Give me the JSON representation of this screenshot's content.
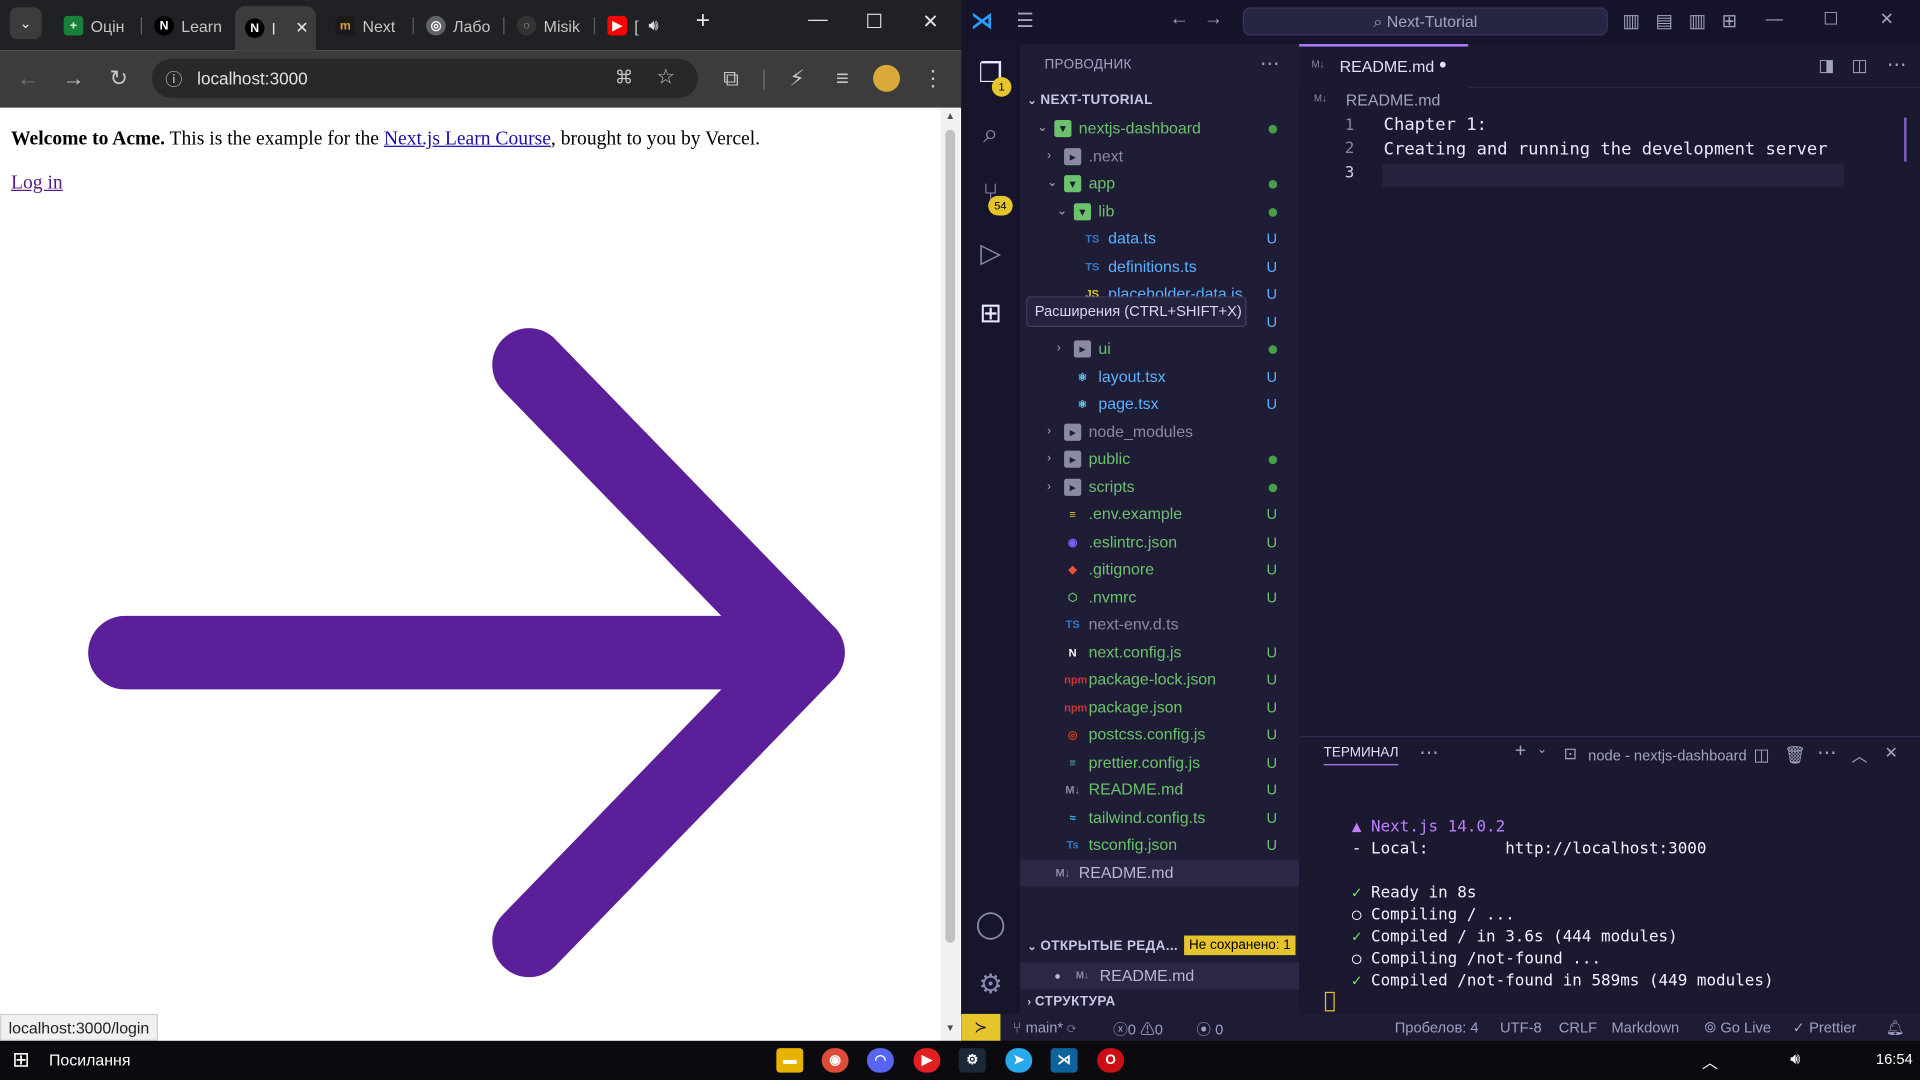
{
  "chrome": {
    "tabs": [
      {
        "title": "Оцін",
        "favicon": "sheets-icon",
        "color": "#188038"
      },
      {
        "title": "Learn",
        "favicon": "nextjs-icon",
        "color": "#000000"
      },
      {
        "title": "l",
        "favicon": "nextjs-icon",
        "color": "#000000"
      },
      {
        "title": "Next",
        "favicon": "dev-icon",
        "color": "#e5a233"
      },
      {
        "title": "Лабо",
        "favicon": "globe-icon",
        "color": "#5f6368"
      },
      {
        "title": "Misik",
        "favicon": "github-icon",
        "color": "#333333"
      },
      {
        "title": "[",
        "favicon": "youtube-icon",
        "color": "#ff0000"
      }
    ],
    "new_tab": "+",
    "url": "localhost:3000",
    "status_url": "localhost:3000/login"
  },
  "page": {
    "welcome_bold": "Welcome to Acme.",
    "welcome_rest_1": " This is the example for the ",
    "course_link": "Next.js Learn Course",
    "welcome_rest_2": ", brought to you by Vercel.",
    "login_link": "Log in",
    "arrow_color": "#5b1f9a"
  },
  "vscode": {
    "search": "Next-Tutorial",
    "explorer_title": "ПРОВОДНИК",
    "root": "NEXT-TUTORIAL",
    "tree": [
      {
        "name": "nextjs-dashboard",
        "kind": "folder-open",
        "status": "dot",
        "color": "#6cc26c"
      },
      {
        "name": ".next",
        "kind": "folder",
        "status": "",
        "color": "#8a8aa5"
      },
      {
        "name": "app",
        "kind": "folder-open",
        "status": "dot",
        "color": "#6cc26c"
      },
      {
        "name": "lib",
        "kind": "folder-open",
        "status": "dot",
        "color": "#6cc26c"
      },
      {
        "name": "data.ts",
        "kind": "ts",
        "status": "U",
        "color": "#5ab1ff"
      },
      {
        "name": "definitions.ts",
        "kind": "ts",
        "status": "U",
        "color": "#5ab1ff"
      },
      {
        "name": "placeholder-data.js",
        "kind": "js",
        "status": "U",
        "color": "#5ab1ff"
      },
      {
        "name": "",
        "kind": "blank",
        "status": "U",
        "color": "#5ab1ff"
      },
      {
        "name": "ui",
        "kind": "folder",
        "status": "dot",
        "color": "#6cc26c"
      },
      {
        "name": "layout.tsx",
        "kind": "react",
        "status": "U",
        "color": "#5ab1ff"
      },
      {
        "name": "page.tsx",
        "kind": "react",
        "status": "U",
        "color": "#5ab1ff"
      },
      {
        "name": "node_modules",
        "kind": "folder",
        "status": "",
        "color": "#8a8aa5"
      },
      {
        "name": "public",
        "kind": "folder",
        "status": "dot",
        "color": "#6cc26c"
      },
      {
        "name": "scripts",
        "kind": "folder",
        "status": "dot",
        "color": "#6cc26c"
      },
      {
        "name": ".env.example",
        "kind": "file",
        "status": "U",
        "color": "#6cc26c"
      },
      {
        "name": ".eslintrc.json",
        "kind": "eslint",
        "status": "U",
        "color": "#6cc26c"
      },
      {
        "name": ".gitignore",
        "kind": "git",
        "status": "U",
        "color": "#6cc26c"
      },
      {
        "name": ".nvmrc",
        "kind": "node",
        "status": "U",
        "color": "#6cc26c"
      },
      {
        "name": "next-env.d.ts",
        "kind": "ts",
        "status": "",
        "color": "#8a8aa5"
      },
      {
        "name": "next.config.js",
        "kind": "next",
        "status": "U",
        "color": "#6cc26c"
      },
      {
        "name": "package-lock.json",
        "kind": "npm",
        "status": "U",
        "color": "#6cc26c"
      },
      {
        "name": "package.json",
        "kind": "npm",
        "status": "U",
        "color": "#6cc26c"
      },
      {
        "name": "postcss.config.js",
        "kind": "postcss",
        "status": "U",
        "color": "#6cc26c"
      },
      {
        "name": "prettier.config.js",
        "kind": "prettier",
        "status": "U",
        "color": "#6cc26c"
      },
      {
        "name": "README.md",
        "kind": "md",
        "status": "U",
        "color": "#6cc26c"
      },
      {
        "name": "tailwind.config.ts",
        "kind": "tailwind",
        "status": "U",
        "color": "#6cc26c"
      },
      {
        "name": "tsconfig.json",
        "kind": "tsconfig",
        "status": "U",
        "color": "#6cc26c"
      },
      {
        "name": "README.md",
        "kind": "md",
        "status": "",
        "color": "#b8b8d0"
      }
    ],
    "open_editors": "ОТКРЫТЫЕ РЕДА...",
    "not_saved": "Не сохранено: 1",
    "open_file": "README.md",
    "outline": "СТРУКТУРА",
    "tooltip": "Расширения (CTRL+SHIFT+X)",
    "explorer_badge": "1",
    "scm_badge": "54",
    "editor_tab": "README.md",
    "breadcrumb": "README.md",
    "lines": [
      "Chapter 1:",
      "Creating and running the development server",
      ""
    ],
    "line_numbers": [
      "1",
      "2",
      "3"
    ],
    "panel_title": "ТЕРМИНАЛ",
    "terminal_name": "node - nextjs-dashboard",
    "terminal": [
      {
        "mark": "▲",
        "text": " Next.js 14.0.2",
        "color": "#c07fff"
      },
      {
        "mark": "",
        "text": "- Local:        http://localhost:3000",
        "color": "#f2f2ff"
      },
      {
        "mark": "",
        "text": "",
        "color": "#f2f2ff"
      },
      {
        "mark": "✓",
        "text": " Ready in 8s",
        "color": "#6ee26e"
      },
      {
        "mark": "○",
        "text": " Compiling / ...",
        "color": "#f2f2ff"
      },
      {
        "mark": "✓",
        "text": " Compiled / in 3.6s (444 modules)",
        "color": "#6ee26e"
      },
      {
        "mark": "○",
        "text": " Compiling /not-found ...",
        "color": "#f2f2ff"
      },
      {
        "mark": "✓",
        "text": " Compiled /not-found in 589ms (449 modules)",
        "color": "#6ee26e"
      }
    ],
    "status": {
      "branch": "main*",
      "errors": "0",
      "warnings": "0",
      "ports": "0",
      "spaces": "Пробелов: 4",
      "encoding": "UTF-8",
      "eol": "CRLF",
      "language": "Markdown",
      "golive": "Go Live",
      "prettier": "Prettier"
    }
  },
  "taskbar": {
    "search_label": "Посилання",
    "time": "16:54"
  }
}
